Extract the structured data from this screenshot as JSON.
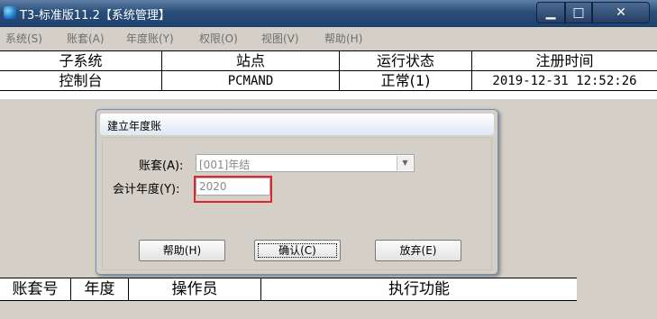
{
  "window": {
    "title": "T3-标准版11.2【系统管理】",
    "buttons": {
      "minimize": "▁",
      "maximize": "□",
      "close": "✕"
    }
  },
  "menu": [
    "系统(S)",
    "账套(A)",
    "年度账(Y)",
    "权限(O)",
    "视图(V)",
    "帮助(H)"
  ],
  "top_table": {
    "headers": [
      "子系统",
      "站点",
      "运行状态",
      "注册时间"
    ],
    "rows": [
      [
        "控制台",
        "PCMAND",
        "正常(1)",
        "2019-12-31 12:52:26"
      ]
    ]
  },
  "bottom_table": {
    "headers": [
      "账套号",
      "年度",
      "操作员",
      "执行功能"
    ]
  },
  "dialog": {
    "title": "建立年度账",
    "account_label": "账套(A):",
    "account_value": "[001]年结",
    "year_label": "会计年度(Y):",
    "year_value": "2020",
    "buttons": {
      "help": "帮助(H)",
      "ok": "确认(C)",
      "cancel": "放弃(E)"
    }
  },
  "colors": {
    "highlight": "#e0262c",
    "titlebar": "#2a4f79"
  }
}
